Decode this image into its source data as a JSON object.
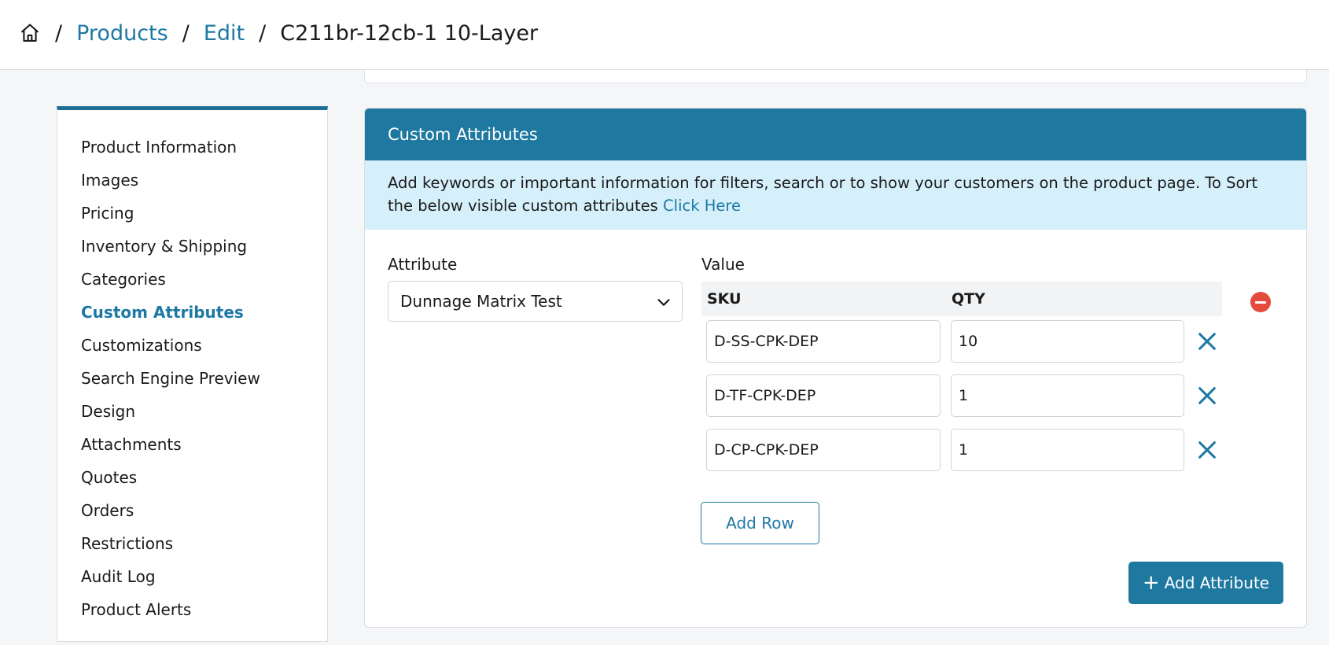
{
  "breadcrumb": {
    "home_icon": "home-icon",
    "items": [
      {
        "label": "Products"
      },
      {
        "label": "Edit"
      },
      {
        "label": "C211br-12cb-1 10-Layer"
      }
    ],
    "separator": "/"
  },
  "sidebar": {
    "items": [
      {
        "label": "Product Information"
      },
      {
        "label": "Images"
      },
      {
        "label": "Pricing"
      },
      {
        "label": "Inventory & Shipping"
      },
      {
        "label": "Categories"
      },
      {
        "label": "Custom Attributes"
      },
      {
        "label": "Customizations"
      },
      {
        "label": "Search Engine Preview"
      },
      {
        "label": "Design"
      },
      {
        "label": "Attachments"
      },
      {
        "label": "Quotes"
      },
      {
        "label": "Orders"
      },
      {
        "label": "Restrictions"
      },
      {
        "label": "Audit Log"
      },
      {
        "label": "Product Alerts"
      }
    ],
    "active_index": 5
  },
  "custom_attributes": {
    "title": "Custom Attributes",
    "info_text": "Add keywords or important information for filters, search or to show your customers on the product page. To Sort the below visible custom attributes",
    "info_link": "Click Here",
    "attribute_label": "Attribute",
    "attribute_value": "Dunnage Matrix Test",
    "value_label": "Value",
    "columns": {
      "sku": "SKU",
      "qty": "QTY"
    },
    "rows": [
      {
        "sku": "D-SS-CPK-DEP",
        "qty": "10"
      },
      {
        "sku": "D-TF-CPK-DEP",
        "qty": "1"
      },
      {
        "sku": "D-CP-CPK-DEP",
        "qty": "1"
      }
    ],
    "add_row_label": "Add Row",
    "add_attribute_label": "Add Attribute"
  },
  "colors": {
    "accent": "#1e78a0",
    "link": "#1e78a4",
    "info_bg": "#d6f0fb",
    "remove": "#e54b3c"
  }
}
